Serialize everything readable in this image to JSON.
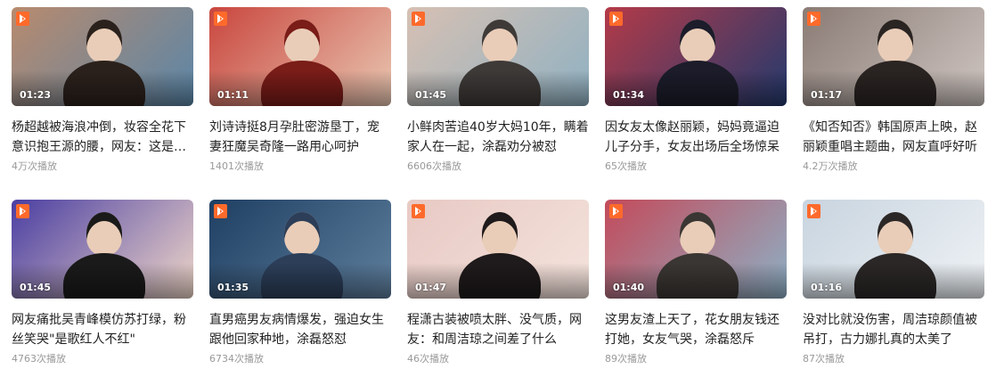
{
  "videos": [
    {
      "duration": "01:23",
      "title": "杨超越被海浪冲倒，妆容全花下意识抱王源的腰，网友：这是什么神仙爱情",
      "plays": "4万次播放",
      "bg1": "#b88a6e",
      "bg2": "#5a86a8",
      "fig": "#2b211c"
    },
    {
      "duration": "01:11",
      "title": "刘诗诗挺8月孕肚密游垦丁，宠妻狂魔吴奇隆一路用心呵护",
      "plays": "1401次播放",
      "bg1": "#c9463e",
      "bg2": "#e9c7b2",
      "fig": "#7a1c18"
    },
    {
      "duration": "01:45",
      "title": "小鲜肉苦追40岁大妈10年，瞒着家人在一起，涂磊劝分被怼",
      "plays": "6606次播放",
      "bg1": "#d7c0b3",
      "bg2": "#8fb1c2",
      "fig": "#3e3a38"
    },
    {
      "duration": "01:34",
      "title": "因女友太像赵丽颖，妈妈竟逼迫儿子分手，女友出场后全场惊呆",
      "plays": "65次播放",
      "bg1": "#b43a48",
      "bg2": "#223a6e",
      "fig": "#1c1c2a"
    },
    {
      "duration": "01:17",
      "title": "《知否知否》韩国原声上映，赵丽颖重唱主题曲，网友直呼好听",
      "plays": "4.2万次播放",
      "bg1": "#8a7b74",
      "bg2": "#cfc6c2",
      "fig": "#2a2422"
    },
    {
      "duration": "01:45",
      "title": "网友痛批吴青峰模仿苏打绿，粉丝笑哭\"是歌红人不红\"",
      "plays": "4763次播放",
      "bg1": "#4a3ea2",
      "bg2": "#f0d7c9",
      "fig": "#1a1a1a"
    },
    {
      "duration": "01:35",
      "title": "直男癌男友病情爆发，强迫女生跟他回家种地，涂磊怒怼",
      "plays": "6734次播放",
      "bg1": "#1f3f63",
      "bg2": "#5f7f9d",
      "fig": "#2c3e58"
    },
    {
      "duration": "01:47",
      "title": "程潇古装被喷太胖、没气质，网友：和周洁琼之间差了什么",
      "plays": "46次播放",
      "bg1": "#e8c9c4",
      "bg2": "#f4e3dc",
      "fig": "#1f1a1b"
    },
    {
      "duration": "01:40",
      "title": "这男友渣上天了，花女朋友钱还打她，女友气哭，涂磊怒斥",
      "plays": "89次播放",
      "bg1": "#c34a5a",
      "bg2": "#8db1c6",
      "fig": "#3a3633"
    },
    {
      "duration": "01:16",
      "title": "没对比就没伤害，周洁琼颜值被吊打，古力娜扎真的太美了",
      "plays": "87次播放",
      "bg1": "#c8d4df",
      "bg2": "#eef2f5",
      "fig": "#2b2727"
    }
  ]
}
